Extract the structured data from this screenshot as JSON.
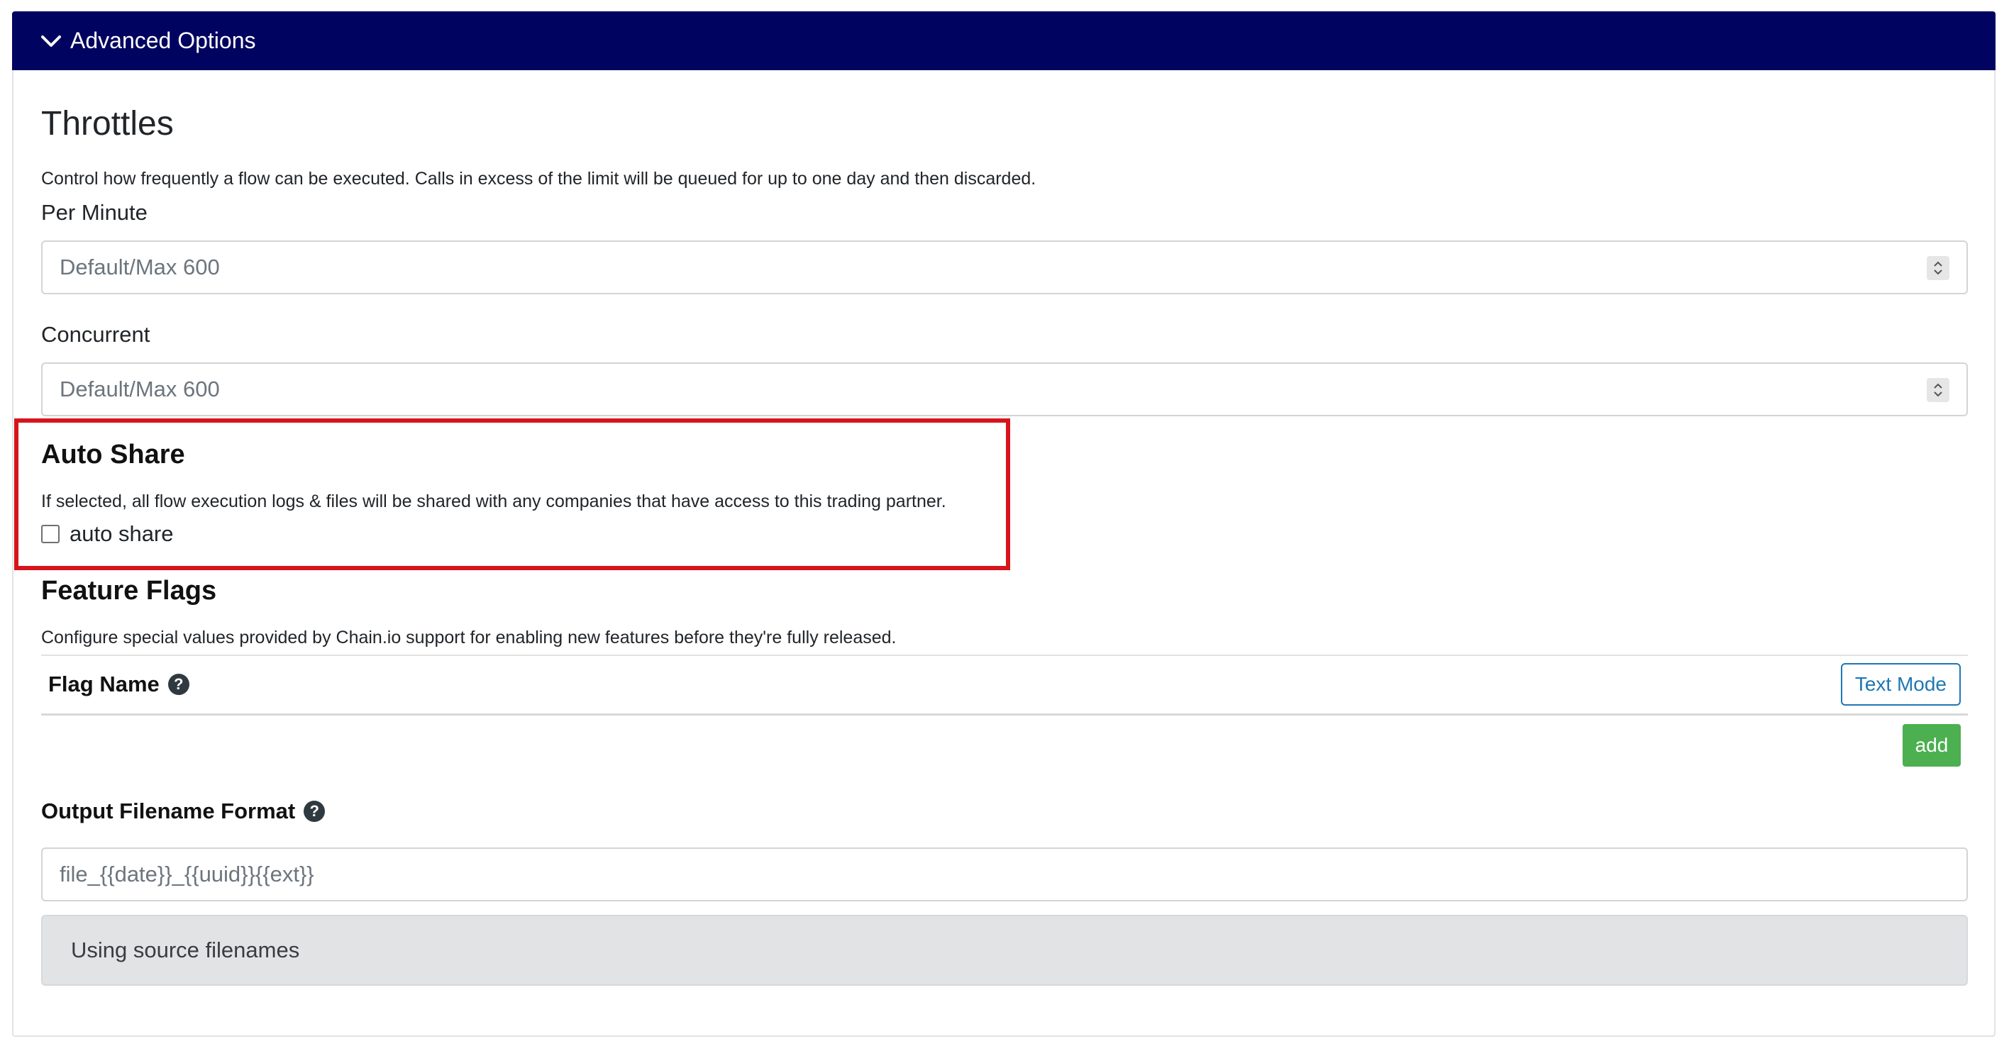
{
  "panel": {
    "header_title": "Advanced Options",
    "header_color": "#00035f",
    "expanded_icon": "chevron-down-icon"
  },
  "throttles": {
    "title": "Throttles",
    "description": "Control how frequently a flow can be executed. Calls in excess of the limit will be queued for up to one day and then discarded.",
    "per_minute": {
      "label": "Per Minute",
      "value": "",
      "placeholder": "Default/Max 600"
    },
    "concurrent": {
      "label": "Concurrent",
      "value": "",
      "placeholder": "Default/Max 600"
    }
  },
  "auto_share": {
    "title": "Auto Share",
    "description": "If selected, all flow execution logs & files will be shared with any companies that have access to this trading partner.",
    "checkbox_label": "auto share",
    "checked": false,
    "highlight_color": "#d7141c"
  },
  "feature_flags": {
    "title": "Feature Flags",
    "description": "Configure special values provided by Chain.io support for enabling new features before they're fully released.",
    "column_header": "Flag Name",
    "help_glyph": "?",
    "text_mode_label": "Text Mode",
    "add_label": "add",
    "add_color": "#4caf50"
  },
  "output_filename": {
    "label": "Output Filename Format",
    "help_glyph": "?",
    "value": "",
    "placeholder": "file_{{date}}_{{uuid}}{{ext}}",
    "info": "Using source filenames"
  }
}
